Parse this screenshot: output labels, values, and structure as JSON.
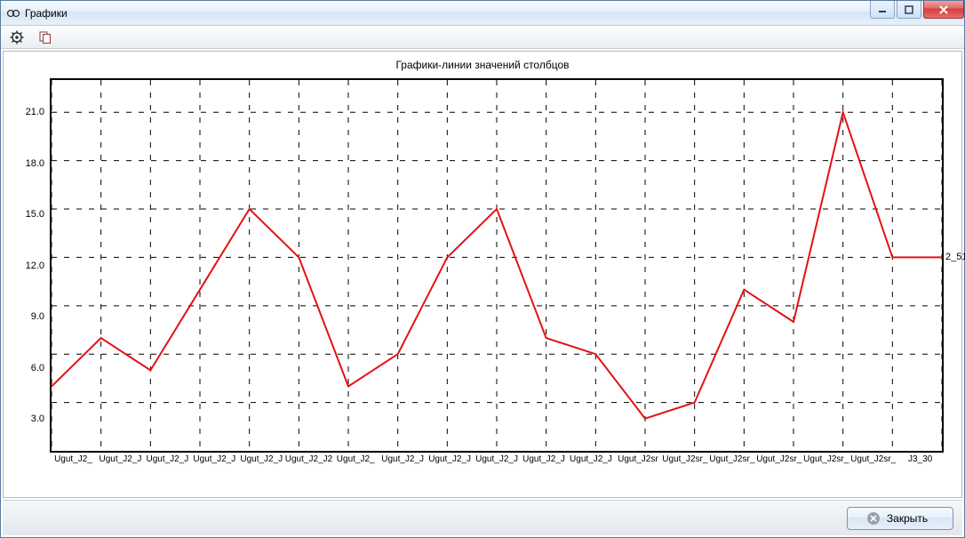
{
  "window": {
    "title": "Графики"
  },
  "toolbar": {
    "settings_name": "settings-icon",
    "copy_name": "copy-icon"
  },
  "chart": {
    "title": "Графики-линии значений столбцов"
  },
  "bottom": {
    "close_label": "Закрыть"
  },
  "chart_data": {
    "type": "line",
    "title": "Графики-линии значений столбцов",
    "ylim": [
      0,
      23
    ],
    "y_ticks": [
      3.0,
      6.0,
      9.0,
      12.0,
      15.0,
      18.0,
      21.0
    ],
    "categories": [
      "Ugut_J2_",
      "Ugut_J2_J",
      "Ugut_J2_J",
      "Ugut_J2_J",
      "Ugut_J2_J",
      "Ugut_J2_J2s",
      "Ugut_J2_",
      "Ugut_J2_J",
      "Ugut_J2_J",
      "Ugut_J2_J",
      "Ugut_J2_J",
      "Ugut_J2_J",
      "Ugut_J2sr",
      "Ugut_J2sr_",
      "Ugut_J2sr_",
      "Ugut_J2sr_",
      "Ugut_J2sr_",
      "Ugut_J2sr_",
      "J3_30"
    ],
    "values": [
      4,
      7,
      5,
      10,
      15,
      12,
      4,
      6,
      12,
      15,
      7,
      6,
      2,
      3,
      10,
      8,
      21,
      12,
      12
    ],
    "end_label": "2_51",
    "series_color": "#e31212"
  }
}
